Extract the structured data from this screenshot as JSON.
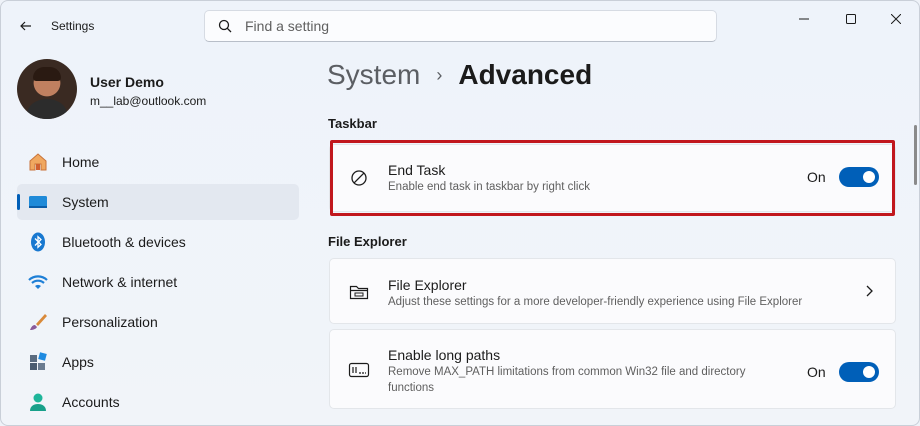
{
  "window": {
    "app_title": "Settings"
  },
  "search": {
    "placeholder": "Find a setting"
  },
  "profile": {
    "name": "User Demo",
    "email": "m__lab@outlook.com"
  },
  "sidebar": {
    "items": [
      {
        "label": "Home",
        "icon": "home-icon",
        "active": false
      },
      {
        "label": "System",
        "icon": "system-icon",
        "active": true
      },
      {
        "label": "Bluetooth & devices",
        "icon": "bluetooth-icon",
        "active": false
      },
      {
        "label": "Network & internet",
        "icon": "wifi-icon",
        "active": false
      },
      {
        "label": "Personalization",
        "icon": "brush-icon",
        "active": false
      },
      {
        "label": "Apps",
        "icon": "apps-icon",
        "active": false
      },
      {
        "label": "Accounts",
        "icon": "accounts-icon",
        "active": false
      }
    ]
  },
  "breadcrumb": {
    "parent": "System",
    "separator": "›",
    "current": "Advanced"
  },
  "sections": {
    "taskbar": {
      "title": "Taskbar",
      "end_task": {
        "title": "End Task",
        "description": "Enable end task in taskbar by right click",
        "state": "On",
        "enabled": true
      }
    },
    "file_explorer": {
      "title": "File Explorer",
      "file_explorer_card": {
        "title": "File Explorer",
        "description": "Adjust these settings for a more developer-friendly experience using File Explorer"
      },
      "long_paths": {
        "title": "Enable long paths",
        "description": "Remove MAX_PATH limitations from common Win32 file and directory functions",
        "state": "On",
        "enabled": true
      }
    }
  },
  "colors": {
    "accent": "#005fb8",
    "highlight_border": "#c1171d"
  }
}
